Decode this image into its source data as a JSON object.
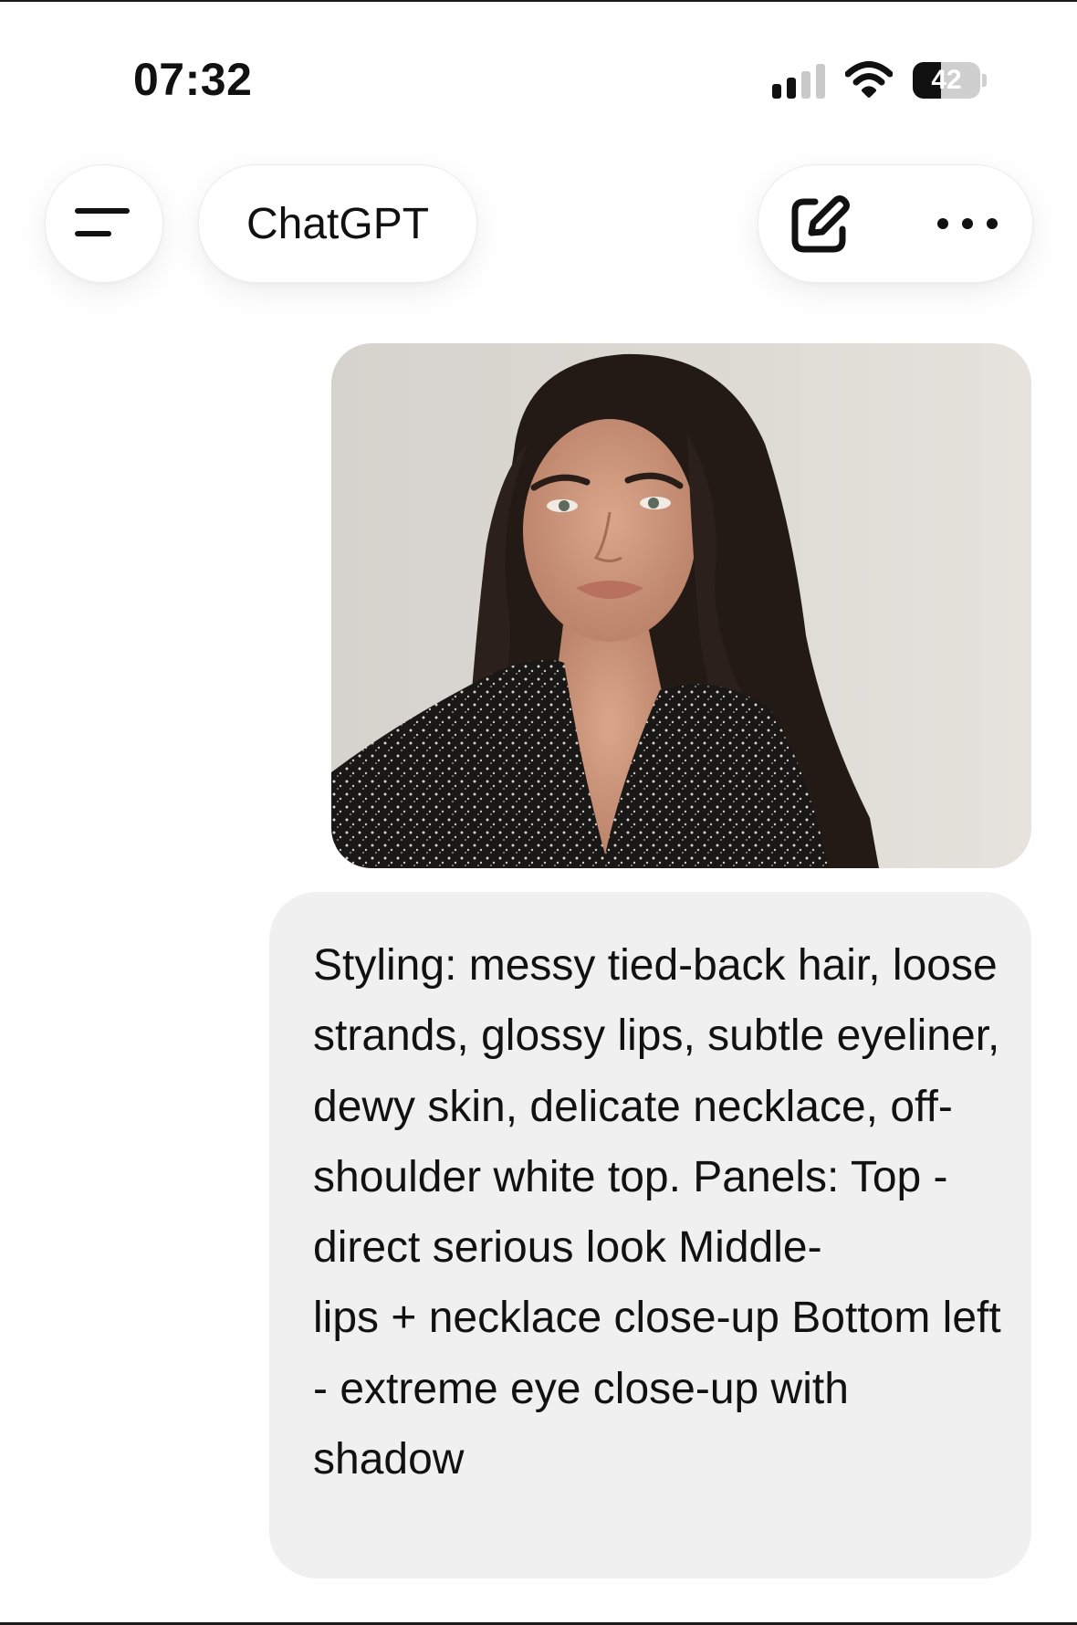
{
  "status_bar": {
    "time": "07:32",
    "battery_level": "42",
    "battery_fraction": 0.42,
    "signal_bars_active": 2,
    "signal_bars_total": 4,
    "icons": [
      "signal-icon",
      "wifi-icon",
      "battery-icon"
    ]
  },
  "header": {
    "menu_icon": "menu-icon",
    "title": "ChatGPT",
    "compose_icon": "new-chat-icon",
    "more_icon": "more-options-icon"
  },
  "conversation": {
    "user_message": {
      "image_description_icon": "attached-photo",
      "text": "Styling: messy tied-back hair, loose strands, glossy lips, subtle eyeliner, dewy skin, delicate necklace, off-\nshoulder white top. Panels: Top - direct serious look Middle-\nlips + necklace close-up Bottom left - extreme eye close-up with shadow"
    }
  },
  "colors": {
    "background": "#ffffff",
    "bubble": "#f0f0f0",
    "text": "#111111"
  }
}
